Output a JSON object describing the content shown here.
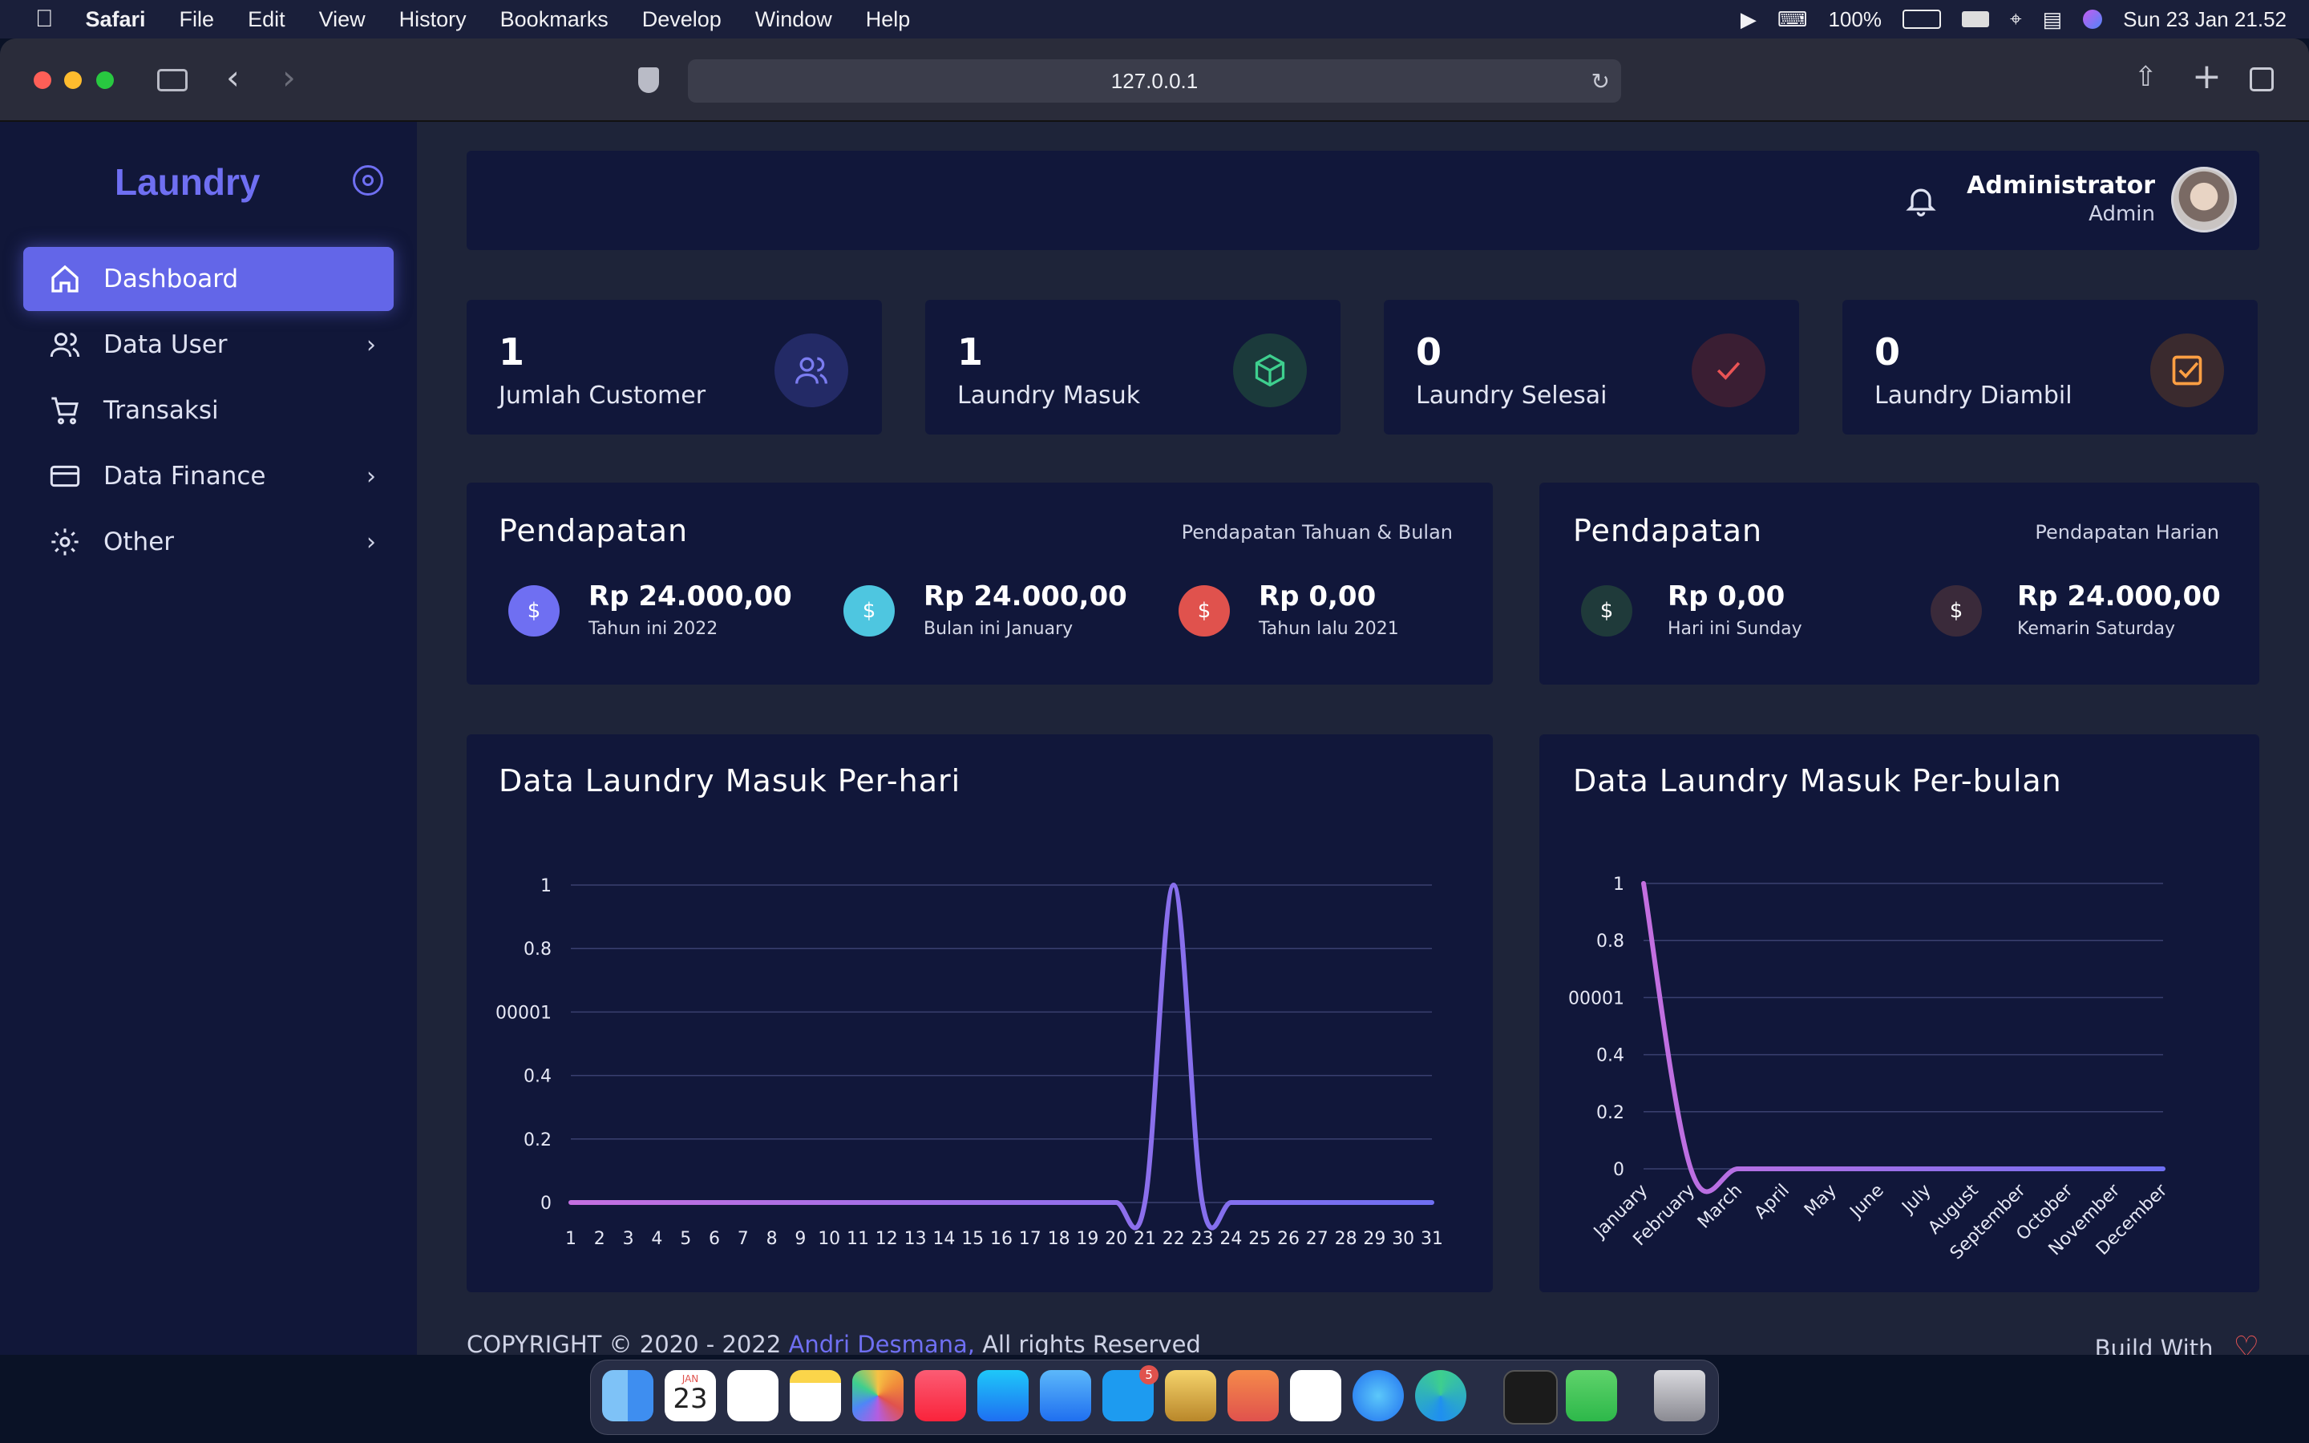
{
  "menubar": {
    "app": "Safari",
    "items": [
      "File",
      "Edit",
      "View",
      "History",
      "Bookmarks",
      "Develop",
      "Window",
      "Help"
    ],
    "battery": "100%",
    "datetime": "Sun 23 Jan  21.52"
  },
  "browser": {
    "url": "127.0.0.1"
  },
  "sidebar": {
    "brand": "Laundry",
    "items": [
      {
        "label": "Dashboard",
        "icon": "home-icon"
      },
      {
        "label": "Data User",
        "icon": "users-icon"
      },
      {
        "label": "Transaksi",
        "icon": "cart-icon"
      },
      {
        "label": "Data Finance",
        "icon": "credit-card-icon"
      },
      {
        "label": "Other",
        "icon": "gear-icon"
      }
    ]
  },
  "header": {
    "user_name": "Administrator",
    "user_role": "Admin"
  },
  "stats": [
    {
      "value": "1",
      "label": "Jumlah Customer",
      "icon": "users-icon",
      "color": "#7b7cf0"
    },
    {
      "value": "1",
      "label": "Laundry Masuk",
      "icon": "box-icon",
      "color": "#3ecf8e"
    },
    {
      "value": "0",
      "label": "Laundry Selesai",
      "icon": "check-icon",
      "color": "#ea5455"
    },
    {
      "value": "0",
      "label": "Laundry Diambil",
      "icon": "checkbox-icon",
      "color": "#ff9f43"
    }
  ],
  "income_year_month": {
    "title": "Pendapatan",
    "subtitle": "Pendapatan Tahuan & Bulan",
    "items": [
      {
        "amount": "Rp 24.000,00",
        "label": "Tahun ini 2022",
        "color": "#6f6ff2"
      },
      {
        "amount": "Rp 24.000,00",
        "label": "Bulan ini January",
        "color": "#4ec6e0"
      },
      {
        "amount": "Rp 0,00",
        "label": "Tahun lalu 2021",
        "color": "#e0524d"
      }
    ]
  },
  "income_daily": {
    "title": "Pendapatan",
    "subtitle": "Pendapatan Harian",
    "items": [
      {
        "amount": "Rp 0,00",
        "label": "Hari ini Sunday",
        "color": "#1f3a3a"
      },
      {
        "amount": "Rp 24.000,00",
        "label": "Kemarin Saturday",
        "color": "#3a2a3a"
      }
    ]
  },
  "chart_daily_title": "Data Laundry Masuk Per-hari",
  "chart_monthly_title": "Data Laundry Masuk Per-bulan",
  "chart_data": [
    {
      "type": "line",
      "title": "Data Laundry Masuk Per-hari",
      "x": [
        1,
        2,
        3,
        4,
        5,
        6,
        7,
        8,
        9,
        10,
        11,
        12,
        13,
        14,
        15,
        16,
        17,
        18,
        19,
        20,
        21,
        22,
        23,
        24,
        25,
        26,
        27,
        28,
        29,
        30,
        31
      ],
      "series": [
        {
          "values": [
            0,
            0,
            0,
            0,
            0,
            0,
            0,
            0,
            0,
            0,
            0,
            0,
            0,
            0,
            0,
            0,
            0,
            0,
            0,
            0,
            0,
            1,
            0,
            0,
            0,
            0,
            0,
            0,
            0,
            0,
            0
          ]
        }
      ],
      "y_ticks": [
        "0",
        "0.2",
        "0.4",
        "00001",
        "0.8",
        "1"
      ],
      "ylim": [
        0,
        1
      ],
      "grid": true
    },
    {
      "type": "line",
      "title": "Data Laundry Masuk Per-bulan",
      "categories": [
        "January",
        "February",
        "March",
        "April",
        "May",
        "June",
        "July",
        "August",
        "September",
        "October",
        "November",
        "December"
      ],
      "series": [
        {
          "values": [
            1,
            0,
            0,
            0,
            0,
            0,
            0,
            0,
            0,
            0,
            0,
            0
          ]
        }
      ],
      "y_ticks": [
        "0",
        "0.2",
        "0.4",
        "00001",
        "0.8",
        "1"
      ],
      "ylim": [
        0,
        1
      ],
      "grid": true
    }
  ],
  "footer": {
    "prefix": "COPYRIGHT © 2020 - 2022",
    "author": "Andri Desmana,",
    "suffix": "All rights Reserved",
    "right": "Build With"
  },
  "dock_calendar": {
    "month": "JAN",
    "day": "23"
  },
  "dock_badge": "5"
}
